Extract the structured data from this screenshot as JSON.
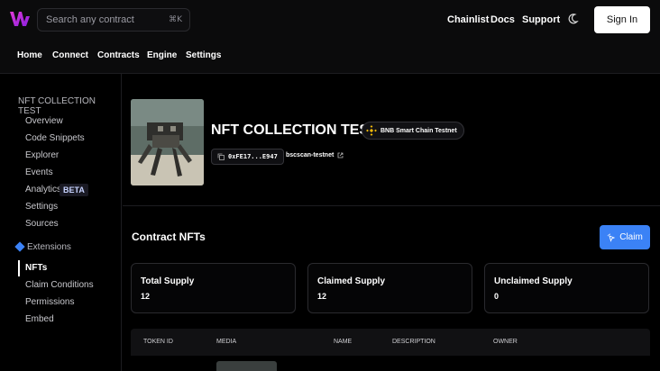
{
  "header": {
    "search": {
      "placeholder": "Search any contract",
      "shortcut": "⌘K"
    },
    "links": [
      "Chainlist",
      "Docs",
      "Support"
    ],
    "theme_icon": "moon-icon",
    "sign_in": "Sign In"
  },
  "subnav": {
    "items": [
      "Home",
      "Connect",
      "Contracts",
      "Engine",
      "Settings"
    ]
  },
  "sidebar": {
    "title": "NFT COLLECTION TEST",
    "items": [
      {
        "label": "Overview"
      },
      {
        "label": "Code Snippets"
      },
      {
        "label": "Explorer"
      },
      {
        "label": "Events"
      },
      {
        "label": "Analytics",
        "badge": "BETA"
      },
      {
        "label": "Settings"
      },
      {
        "label": "Sources"
      }
    ],
    "extensions_label": "Extensions",
    "extension_items": [
      {
        "label": "NFTs",
        "active": true
      },
      {
        "label": "Claim Conditions"
      },
      {
        "label": "Permissions"
      },
      {
        "label": "Embed"
      }
    ]
  },
  "contract": {
    "name": "NFT COLLECTION TEST",
    "chain": "BNB Smart Chain Testnet",
    "address": "0xFE17...E947",
    "explorer": "bscscan-testnet"
  },
  "nfts": {
    "title": "Contract NFTs",
    "claim_button": "Claim",
    "stats": [
      {
        "label": "Total Supply",
        "value": "12"
      },
      {
        "label": "Claimed Supply",
        "value": "12"
      },
      {
        "label": "Unclaimed Supply",
        "value": "0"
      }
    ],
    "table_headers": [
      "TOKEN ID",
      "MEDIA",
      "NAME",
      "DESCRIPTION",
      "OWNER"
    ]
  },
  "colors": {
    "accent": "#3b82f6",
    "bnb": "#f0b90b",
    "brand": "#d21ec8"
  }
}
